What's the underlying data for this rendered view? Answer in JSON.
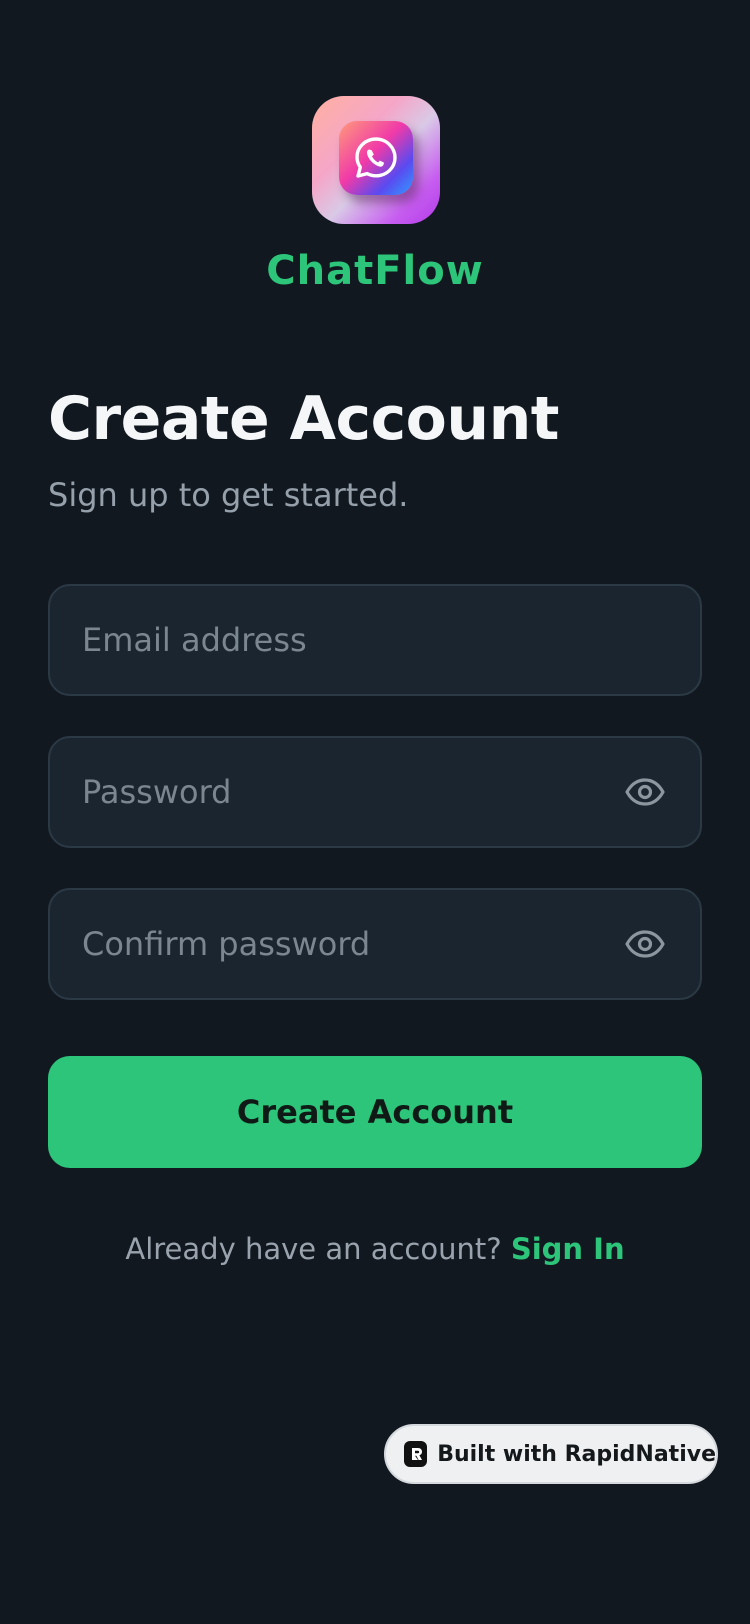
{
  "app": {
    "name": "ChatFlow",
    "icon": "chat-phone-icon",
    "accent_color": "#2dc57a",
    "background_color": "#111820"
  },
  "header": {
    "title": "Create Account",
    "subtitle": "Sign up to get started."
  },
  "form": {
    "email": {
      "placeholder": "Email address",
      "value": ""
    },
    "password": {
      "placeholder": "Password",
      "value": "",
      "toggle_icon": "eye-icon"
    },
    "confirm_password": {
      "placeholder": "Confirm password",
      "value": "",
      "toggle_icon": "eye-icon"
    },
    "submit_label": "Create Account"
  },
  "footer": {
    "prompt": "Already have an account?",
    "link_label": "Sign In"
  },
  "badge": {
    "label": "Built with RapidNative",
    "icon": "rapidnative-logo-icon"
  }
}
